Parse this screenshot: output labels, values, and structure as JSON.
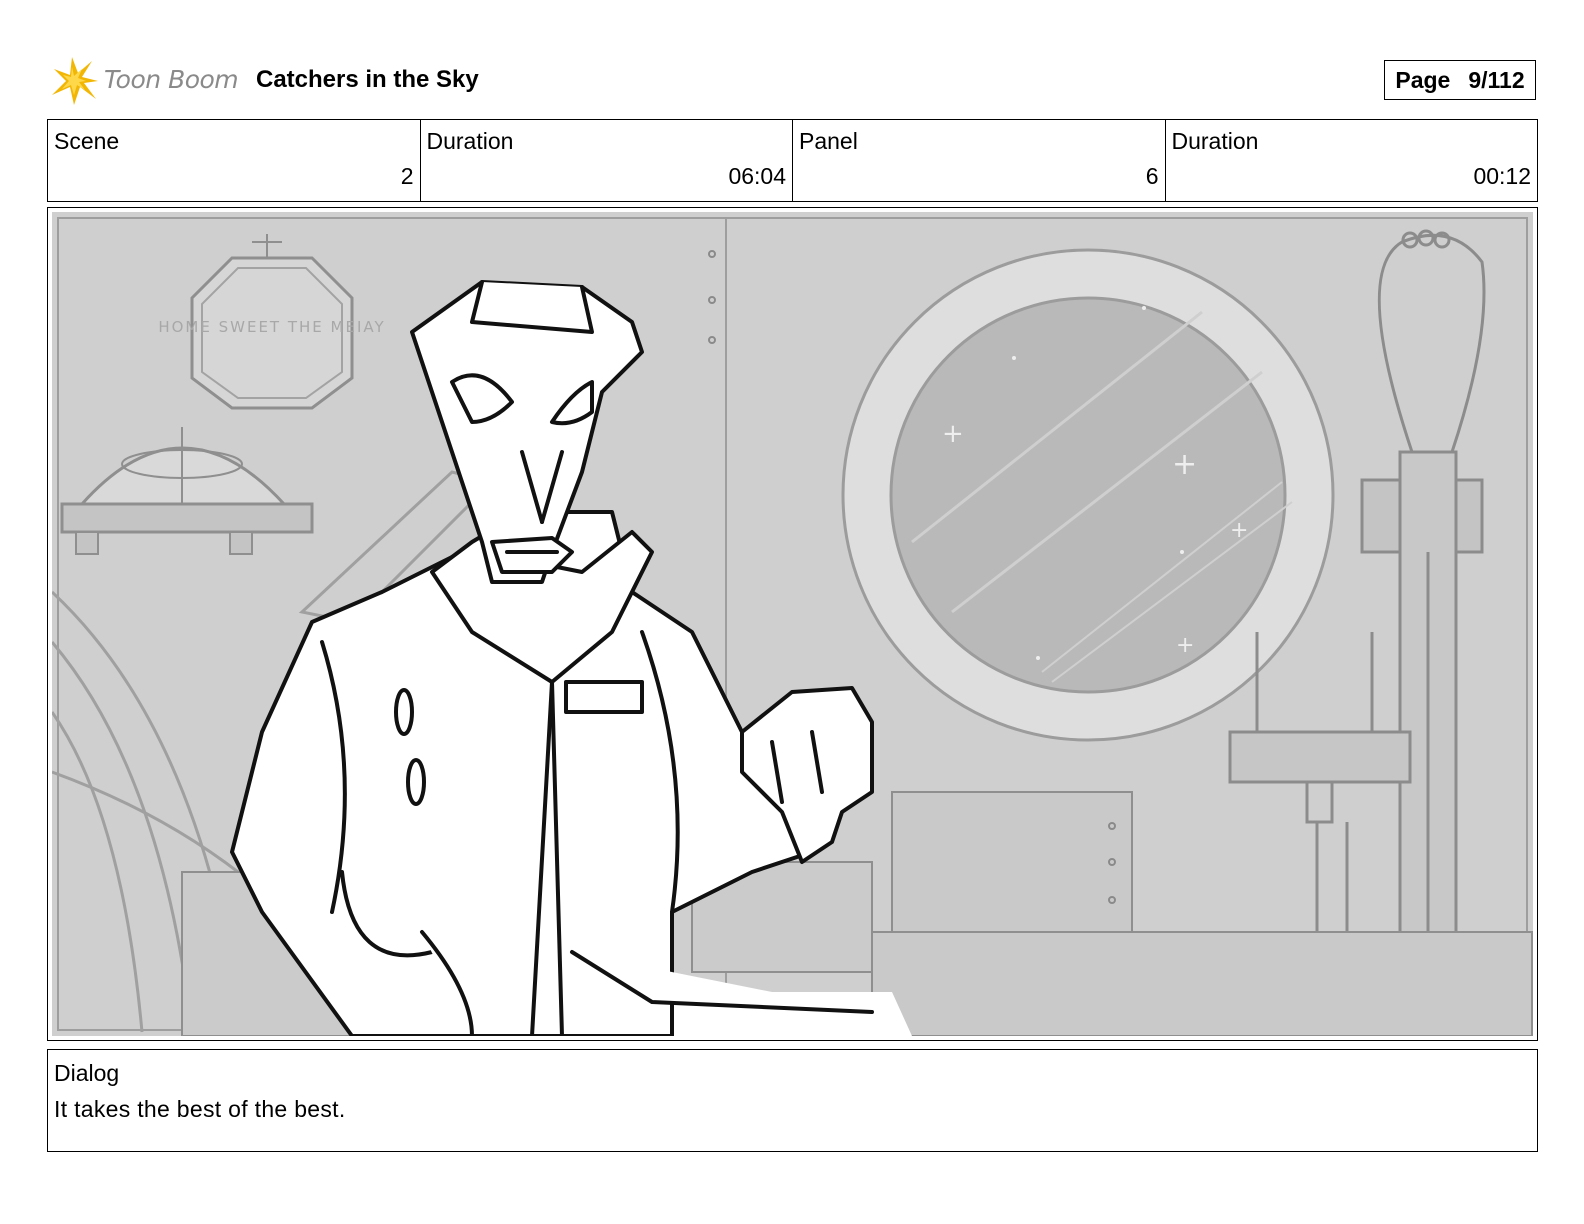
{
  "header": {
    "logo_text": "Toon Boom",
    "project_title": "Catchers in the Sky",
    "page_label": "Page",
    "page_value": "9/112"
  },
  "info": {
    "scene_label": "Scene",
    "scene_value": "2",
    "scene_duration_label": "Duration",
    "scene_duration_value": "06:04",
    "panel_label": "Panel",
    "panel_value": "6",
    "panel_duration_label": "Duration",
    "panel_duration_value": "00:12"
  },
  "sketch": {
    "wall_sign_text": "HOME SWEET THE MEIAY"
  },
  "dialog": {
    "label": "Dialog",
    "text": "It takes the best of the best."
  },
  "colors": {
    "logo_star": "#f2b705",
    "background_gray": "#cfcfcf",
    "sketch_line": "#111111"
  }
}
